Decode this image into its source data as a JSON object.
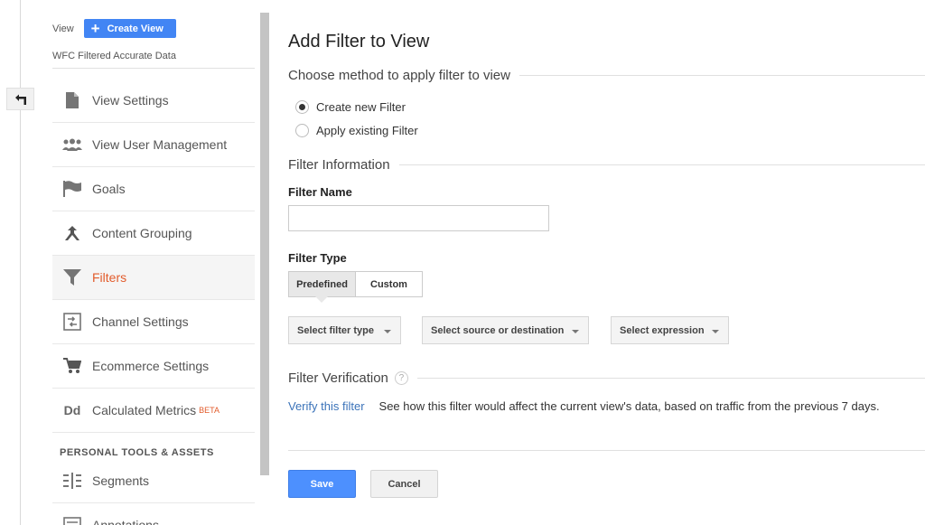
{
  "sidebar": {
    "view_label": "View",
    "create_view_label": "Create View",
    "view_name": "WFC Filtered Accurate Data",
    "items": [
      {
        "label": "View Settings",
        "icon": "document-icon"
      },
      {
        "label": "View User Management",
        "icon": "users-icon"
      },
      {
        "label": "Goals",
        "icon": "flag-icon"
      },
      {
        "label": "Content Grouping",
        "icon": "grouping-icon"
      },
      {
        "label": "Filters",
        "icon": "filter-icon",
        "active": true
      },
      {
        "label": "Channel Settings",
        "icon": "channel-icon"
      },
      {
        "label": "Ecommerce Settings",
        "icon": "cart-icon"
      },
      {
        "label": "Calculated Metrics",
        "icon": "dd-icon",
        "badge": "BETA",
        "icon_text": "Dd"
      }
    ],
    "section_header": "PERSONAL TOOLS & ASSETS",
    "personal_items": [
      {
        "label": "Segments",
        "icon": "segments-icon"
      },
      {
        "label": "Annotations",
        "icon": "annotations-icon"
      }
    ]
  },
  "main": {
    "title": "Add Filter to View",
    "method_heading": "Choose method to apply filter to view",
    "radio_options": [
      {
        "label": "Create new Filter",
        "selected": true
      },
      {
        "label": "Apply existing Filter",
        "selected": false
      }
    ],
    "info_heading": "Filter Information",
    "filter_name_label": "Filter Name",
    "filter_name_value": "",
    "filter_type_label": "Filter Type",
    "type_tabs": [
      {
        "label": "Predefined",
        "selected": true
      },
      {
        "label": "Custom",
        "selected": false
      }
    ],
    "dropdowns": [
      {
        "label": "Select filter type"
      },
      {
        "label": "Select source or destination"
      },
      {
        "label": "Select expression"
      }
    ],
    "verification_heading": "Filter Verification",
    "help_glyph": "?",
    "verify_link": "Verify this filter",
    "verify_description": "See how this filter would affect the current view's data, based on traffic from the previous 7 days.",
    "save_label": "Save",
    "cancel_label": "Cancel"
  },
  "colors": {
    "accent_blue": "#4285f4",
    "active_orange": "#e25c2c",
    "link_blue": "#3b73b9"
  }
}
